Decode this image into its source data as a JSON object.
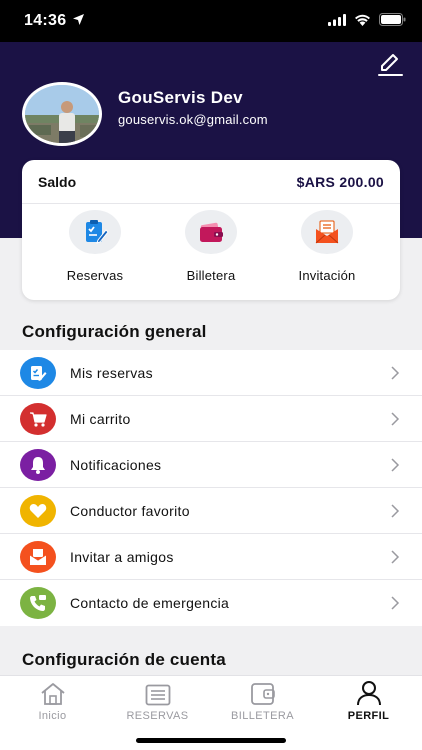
{
  "status_bar": {
    "time": "14:36"
  },
  "profile": {
    "name": "GouServis Dev",
    "email": "gouservis.ok@gmail.com"
  },
  "balance": {
    "label": "Saldo",
    "value": "$ARS 200.00"
  },
  "quick_actions": [
    {
      "label": "Reservas",
      "icon": "clipboard-icon",
      "color": "#1e88e5"
    },
    {
      "label": "Billetera",
      "icon": "wallet-icon",
      "color": "#c2185b"
    },
    {
      "label": "Invitación",
      "icon": "envelope-icon",
      "color": "#e65100"
    }
  ],
  "general_settings": {
    "title": "Configuración general",
    "items": [
      {
        "label": "Mis reservas",
        "icon": "clipboard-icon",
        "color": "#1e88e5"
      },
      {
        "label": "Mi carrito",
        "icon": "cart-icon",
        "color": "#d32f2f"
      },
      {
        "label": "Notificaciones",
        "icon": "bell-icon",
        "color": "#7b1fa2"
      },
      {
        "label": "Conductor favorito",
        "icon": "heart-icon",
        "color": "#f0b400"
      },
      {
        "label": "Invitar a amigos",
        "icon": "envelope-icon",
        "color": "#f4511e"
      },
      {
        "label": "Contacto de emergencia",
        "icon": "phone-icon",
        "color": "#7cb342"
      }
    ]
  },
  "account_settings": {
    "title": "Configuración de cuenta"
  },
  "tabs": [
    {
      "label": "Inicio",
      "icon": "home-icon",
      "active": false
    },
    {
      "label": "RESERVAS",
      "icon": "list-icon",
      "active": false
    },
    {
      "label": "BILLETERA",
      "icon": "wallet-icon",
      "active": false
    },
    {
      "label": "PERFIL",
      "icon": "person-icon",
      "active": true
    }
  ],
  "colors": {
    "header_bg": "#1b1245",
    "page_bg": "#f0f0f2"
  }
}
